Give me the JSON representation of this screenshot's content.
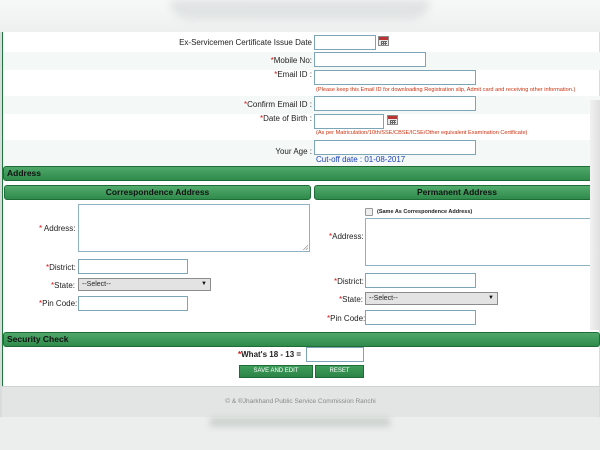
{
  "form": {
    "ex_servicemen_label": "Ex-Servicemen Certificate Issue Date",
    "mobile_label": "Mobile No:",
    "email_label": "Email ID :",
    "email_note": "(Please keep this Email ID for downloading Registration slip, Admit card and receiving other information.)",
    "confirm_email_label": "Confirm Email ID :",
    "dob_label": "Date of Birth :",
    "dob_note": "(As per Matriculation/10th/SSE/CBSE/ICSE/Other equivalent Examination Certificate)",
    "age_label": "Your Age :",
    "cutoff_text": "Cut-off date : 01-08-2017",
    "required_mark": "*"
  },
  "address": {
    "section_title": "Address",
    "correspondence_title": "Correspondence Address",
    "permanent_title": "Permanent Address",
    "address_label": "Address:",
    "district_label": "District:",
    "state_label": "State:",
    "pincode_label": "Pin Code:",
    "state_selected": "--Select--",
    "same_as_label": "(Same As Correspondence Address)"
  },
  "security": {
    "section_title": "Security Check",
    "question": "What's 18 - 13 =",
    "save_label": "SAVE AND EDIT",
    "reset_label": "RESET"
  },
  "footer": {
    "copyright": "© & ®Jharkhand Public Service Commission Ranchi"
  },
  "icons": {
    "calendar": "calendar-icon",
    "dropdown": "chevron-down-icon"
  },
  "colors": {
    "section_green": "#2f8a4c",
    "required_red": "#d11111",
    "cutoff_blue": "#1a3fbf"
  }
}
